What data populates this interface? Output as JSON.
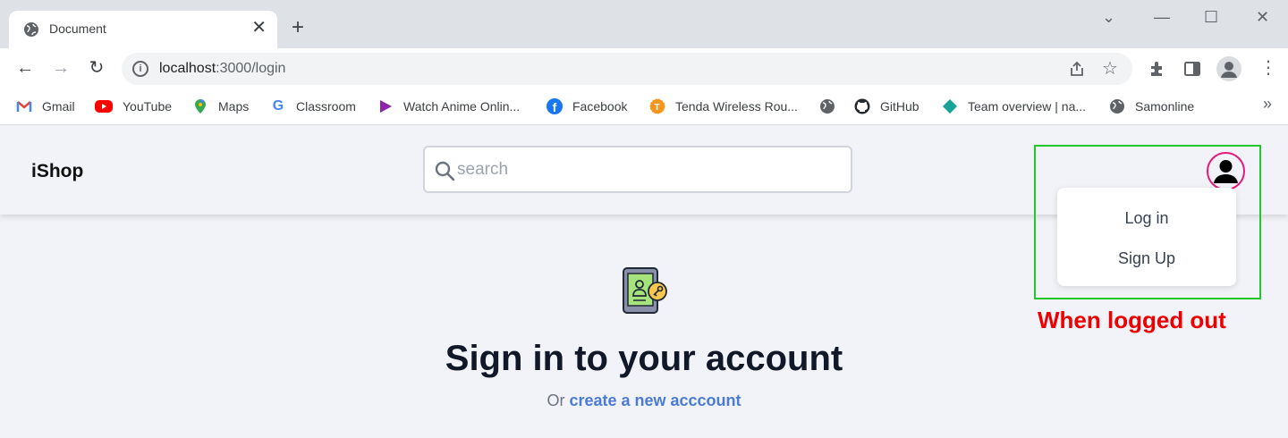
{
  "browser": {
    "tab_title": "Document",
    "new_tab_label": "+",
    "url_host": "localhost",
    "url_path": ":3000/login",
    "window_controls": {
      "chevron": "⌄",
      "minimize": "—",
      "maximize": "☐",
      "close": "✕"
    }
  },
  "bookmarks": [
    {
      "label": "Gmail",
      "icon": "gmail-icon",
      "color": "#ea4335"
    },
    {
      "label": "YouTube",
      "icon": "youtube-icon",
      "color": "#ff0000"
    },
    {
      "label": "Maps",
      "icon": "maps-icon",
      "color": "#34a853"
    },
    {
      "label": "Classroom",
      "icon": "google-icon",
      "color": "#4285f4"
    },
    {
      "label": "Watch Anime Onlin...",
      "icon": "play-icon",
      "color": "#8e24aa"
    },
    {
      "label": "Facebook",
      "icon": "facebook-icon",
      "color": "#1877f2"
    },
    {
      "label": "Tenda Wireless Rou...",
      "icon": "tenda-icon",
      "color": "#f7941d"
    },
    {
      "label": "",
      "icon": "globe-icon",
      "color": "#5f6368"
    },
    {
      "label": "GitHub",
      "icon": "github-icon",
      "color": "#24292e"
    },
    {
      "label": "Team overview | na...",
      "icon": "diamond-icon",
      "color": "#17a398"
    },
    {
      "label": "Samonline",
      "icon": "globe-icon",
      "color": "#5f6368"
    }
  ],
  "bookmarks_more": "»",
  "app": {
    "brand": "iShop",
    "search_placeholder": "search",
    "menu": {
      "login": "Log in",
      "signup": "Sign Up"
    },
    "annotation": "When logged out",
    "heading": "Sign in to your account",
    "subtext_prefix": "Or",
    "subtext_link": "create a new acccount"
  },
  "colors": {
    "highlight": "#22c82a",
    "avatar_ring": "#e5197a",
    "annotation": "#ee0000",
    "link": "#4a7bd6"
  }
}
